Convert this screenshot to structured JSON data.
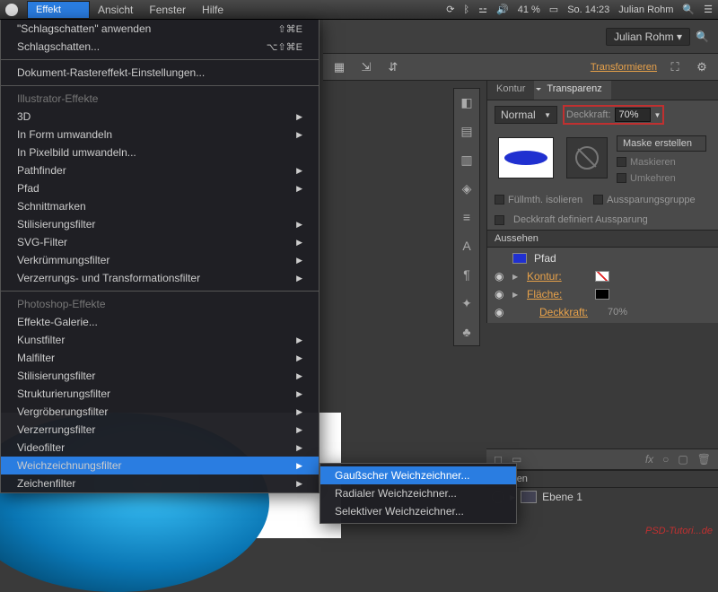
{
  "menubar": {
    "items": [
      "Effekt",
      "Ansicht",
      "Fenster",
      "Hilfe"
    ],
    "battery": "41 %",
    "clock": "So. 14:23",
    "user": "Julian Rohm"
  },
  "dropdown": {
    "apply": "\"Schlagschatten\" anwenden",
    "apply_sc": "⇧⌘E",
    "last": "Schlagschatten...",
    "last_sc": "⌥⇧⌘E",
    "raster": "Dokument-Rastereffekt-Einstellungen...",
    "hdr1": "Illustrator-Effekte",
    "ai": [
      "3D",
      "In Form umwandeln",
      "In Pixelbild umwandeln...",
      "Pathfinder",
      "Pfad",
      "Schnittmarken",
      "Stilisierungsfilter",
      "SVG-Filter",
      "Verkrümmungsfilter",
      "Verzerrungs- und Transformationsfilter"
    ],
    "hdr2": "Photoshop-Effekte",
    "gallery": "Effekte-Galerie...",
    "ps": [
      "Kunstfilter",
      "Malfilter",
      "Stilisierungsfilter",
      "Strukturierungsfilter",
      "Vergröberungsfilter",
      "Verzerrungsfilter",
      "Videofilter",
      "Weichzeichnungsfilter",
      "Zeichenfilter"
    ]
  },
  "submenu": {
    "items": [
      "Gaußscher Weichzeichner...",
      "Radialer Weichzeichner...",
      "Selektiver Weichzeichner..."
    ]
  },
  "workspace": {
    "name": "Julian Rohm"
  },
  "toolbar": {
    "transform": "Transformieren"
  },
  "panel": {
    "tabs": [
      "Kontur",
      "Transparenz"
    ],
    "blend": "Normal",
    "opacity_lbl": "Deckkraft:",
    "opacity_val": "70%",
    "mask_btn": "Maske erstellen",
    "mask_chk1": "Maskieren",
    "mask_chk2": "Umkehren",
    "iso": "Füllmth. isolieren",
    "knock": "Aussparungsgruppe",
    "defop": "Deckkraft definiert Aussparung"
  },
  "appearance": {
    "title": "Aussehen",
    "obj": "Pfad",
    "rows": [
      {
        "name": "Kontur:",
        "val": ""
      },
      {
        "name": "Fläche:",
        "val": ""
      },
      {
        "name": "Deckkraft:",
        "val": "70%"
      }
    ]
  },
  "layers": {
    "title": "Ebenen",
    "row": "Ebene 1"
  },
  "sig": "PSD-Tutori...de"
}
